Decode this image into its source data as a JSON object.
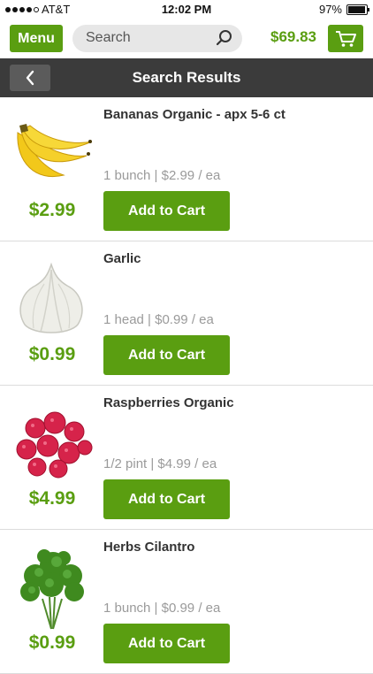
{
  "status_bar": {
    "carrier": "AT&T",
    "time": "12:02 PM",
    "battery": "97%"
  },
  "header": {
    "menu_label": "Menu",
    "search_placeholder": "Search",
    "cart_total": "$69.83"
  },
  "nav": {
    "title": "Search Results"
  },
  "products": [
    {
      "name": "Bananas Organic - apx 5-6 ct",
      "unit": "1 bunch | $2.99 / ea",
      "price": "$2.99",
      "button": "Add to Cart",
      "image": "bananas"
    },
    {
      "name": "Garlic",
      "unit": "1 head | $0.99 / ea",
      "price": "$0.99",
      "button": "Add to Cart",
      "image": "garlic"
    },
    {
      "name": "Raspberries Organic",
      "unit": "1/2 pint | $4.99 / ea",
      "price": "$4.99",
      "button": "Add to Cart",
      "image": "raspberries"
    },
    {
      "name": "Herbs Cilantro",
      "unit": "1 bunch | $0.99 / ea",
      "price": "$0.99",
      "button": "Add to Cart",
      "image": "cilantro"
    }
  ],
  "colors": {
    "brand_green": "#5a9e11",
    "nav_dark": "#3b3b3b"
  }
}
